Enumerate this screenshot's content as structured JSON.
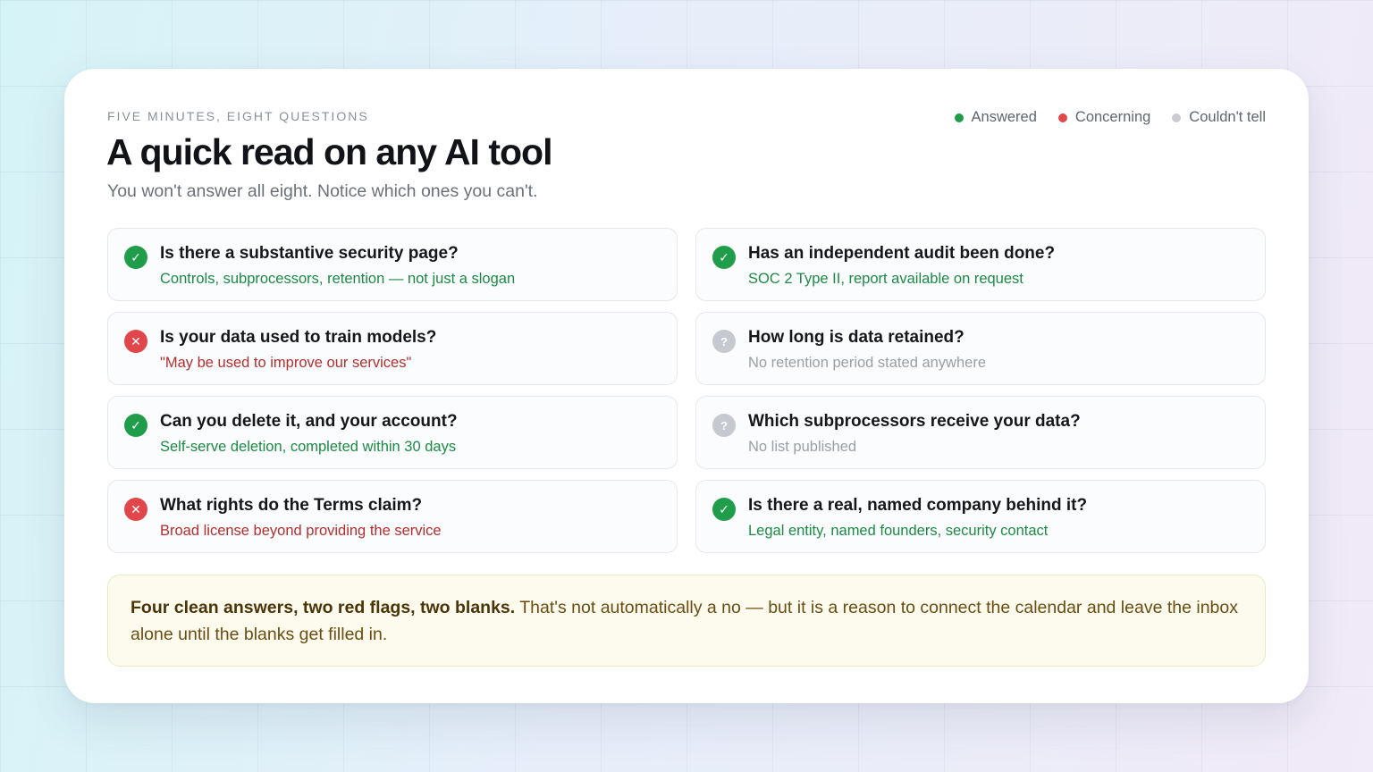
{
  "eyebrow": "FIVE MINUTES, EIGHT QUESTIONS",
  "title": "A quick read on any AI tool",
  "subtitle": "You won't answer all eight. Notice which ones you can't.",
  "legend": [
    {
      "label": "Answered",
      "color": "#1f9d4a"
    },
    {
      "label": "Concerning",
      "color": "#e0464a"
    },
    {
      "label": "Couldn't tell",
      "color": "#c9ccd3"
    }
  ],
  "questions": [
    {
      "title": "Is there a substantive security page?",
      "detail": "Controls, subprocessors, retention — not just a slogan",
      "status": "ok",
      "icon": "check-icon",
      "glyph": "✓"
    },
    {
      "title": "Has an independent audit been done?",
      "detail": "SOC 2 Type II, report available on request",
      "status": "ok",
      "icon": "check-icon",
      "glyph": "✓"
    },
    {
      "title": "Is your data used to train models?",
      "detail": "\"May be used to improve our services\"",
      "status": "bad",
      "icon": "x-icon",
      "glyph": "✕"
    },
    {
      "title": "How long is data retained?",
      "detail": "No retention period stated anywhere",
      "status": "unknown",
      "icon": "question-icon",
      "glyph": "?"
    },
    {
      "title": "Can you delete it, and your account?",
      "detail": "Self-serve deletion, completed within 30 days",
      "status": "ok",
      "icon": "check-icon",
      "glyph": "✓"
    },
    {
      "title": "Which subprocessors receive your data?",
      "detail": "No list published",
      "status": "unknown",
      "icon": "question-icon",
      "glyph": "?"
    },
    {
      "title": "What rights do the Terms claim?",
      "detail": "Broad license beyond providing the service",
      "status": "bad",
      "icon": "x-icon",
      "glyph": "✕"
    },
    {
      "title": "Is there a real, named company behind it?",
      "detail": "Legal entity, named founders, security contact",
      "status": "ok",
      "icon": "check-icon",
      "glyph": "✓"
    }
  ],
  "summary": {
    "bold": "Four clean answers, two red flags, two blanks.",
    "rest": " That's not automatically a no — but it is a reason to connect the calendar and leave the inbox alone until the blanks get filled in."
  }
}
